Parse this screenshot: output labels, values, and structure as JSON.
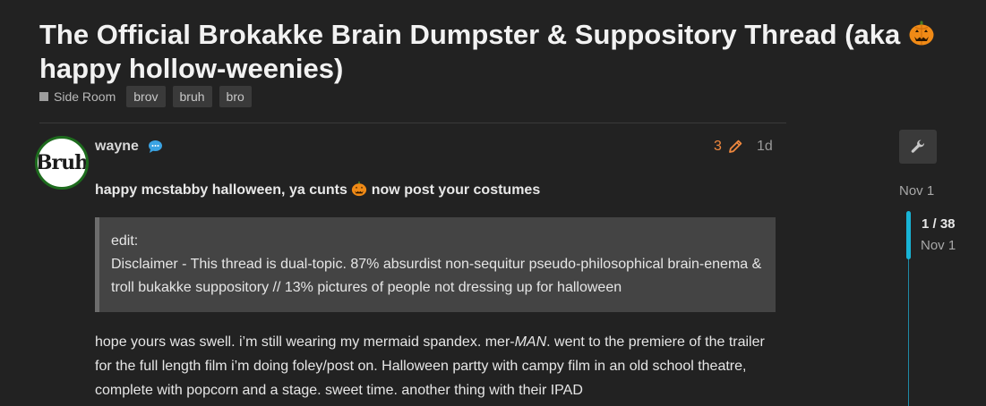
{
  "topic": {
    "title_main": "The Official Brokakke Brain Dumpster & Suppository Thread (aka ",
    "title_tail": "happy hollow-weenies)",
    "category": "Side Room",
    "tags": [
      "brov",
      "bruh",
      "bro"
    ]
  },
  "post": {
    "avatar_text": "Bruh",
    "username": "wayne",
    "edit_count": "3",
    "age": "1d",
    "lead_before": "happy mcstabby halloween, ya cunts ",
    "lead_after": " now post your costumes",
    "quote_line1": "edit:",
    "quote_line2": "Disclaimer - This thread is dual-topic. 87% absurdist non-sequitur pseudo-philosophical brain-enema & troll bukakke suppository // 13% pictures of people not dressing up for halloween",
    "para_before": "hope yours was swell. i’m still wearing my mermaid spandex. mer-",
    "para_emph": "MAN",
    "para_after": ". went to the premiere of the trailer for the full length film i’m doing foley/post on. Halloween partty with campy film in an old school theatre, complete with popcorn and a stage. sweet time. another thing with their IPAD"
  },
  "timeline": {
    "start_date": "Nov 1",
    "position": "1 / 38",
    "current_date": "Nov 1"
  },
  "colors": {
    "background": "#222222",
    "accent": "#18b4d6",
    "edit_badge": "#f0883e",
    "avatar_border": "#1d6b1d"
  },
  "icons": [
    "pumpkin-icon",
    "chat-bubble-icon",
    "pencil-icon",
    "wrench-icon"
  ]
}
